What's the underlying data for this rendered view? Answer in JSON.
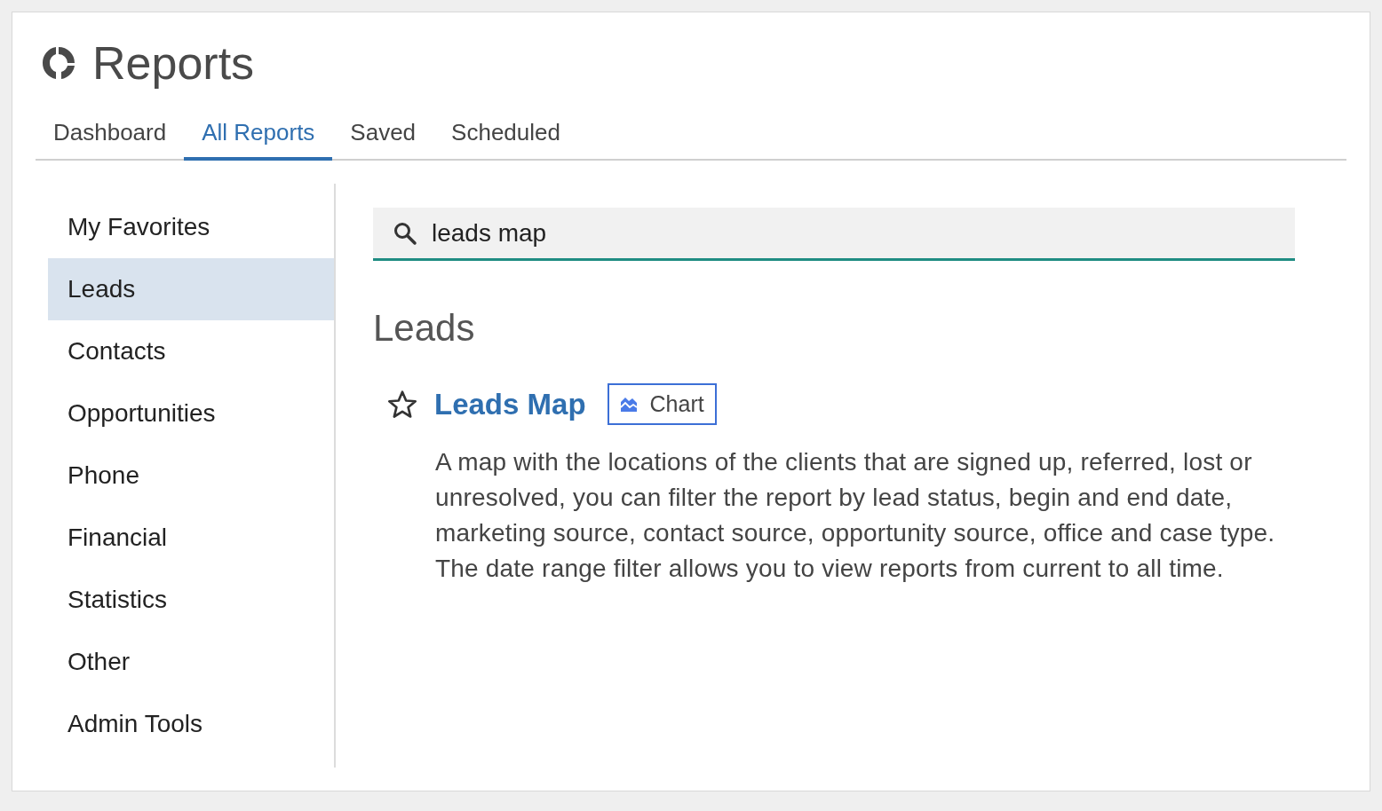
{
  "header": {
    "title": "Reports"
  },
  "tabs": [
    {
      "label": "Dashboard",
      "selected": false
    },
    {
      "label": "All Reports",
      "selected": true
    },
    {
      "label": "Saved",
      "selected": false
    },
    {
      "label": "Scheduled",
      "selected": false
    }
  ],
  "sidebar": {
    "items": [
      {
        "label": "My Favorites",
        "selected": false
      },
      {
        "label": "Leads",
        "selected": true
      },
      {
        "label": "Contacts",
        "selected": false
      },
      {
        "label": "Opportunities",
        "selected": false
      },
      {
        "label": "Phone",
        "selected": false
      },
      {
        "label": "Financial",
        "selected": false
      },
      {
        "label": "Statistics",
        "selected": false
      },
      {
        "label": "Other",
        "selected": false
      },
      {
        "label": "Admin Tools",
        "selected": false
      }
    ]
  },
  "search": {
    "value": "leads map"
  },
  "section": {
    "title": "Leads",
    "reports": [
      {
        "name": "Leads Map",
        "favorite": false,
        "badge": "Chart",
        "description": "A map with the locations of the clients that are signed up, referred, lost or unresolved, you can filter the report by lead status, begin and end date, marketing source, contact source, opportunity source, office and case type. The date range filter allows you to view reports from current to all time."
      }
    ]
  }
}
